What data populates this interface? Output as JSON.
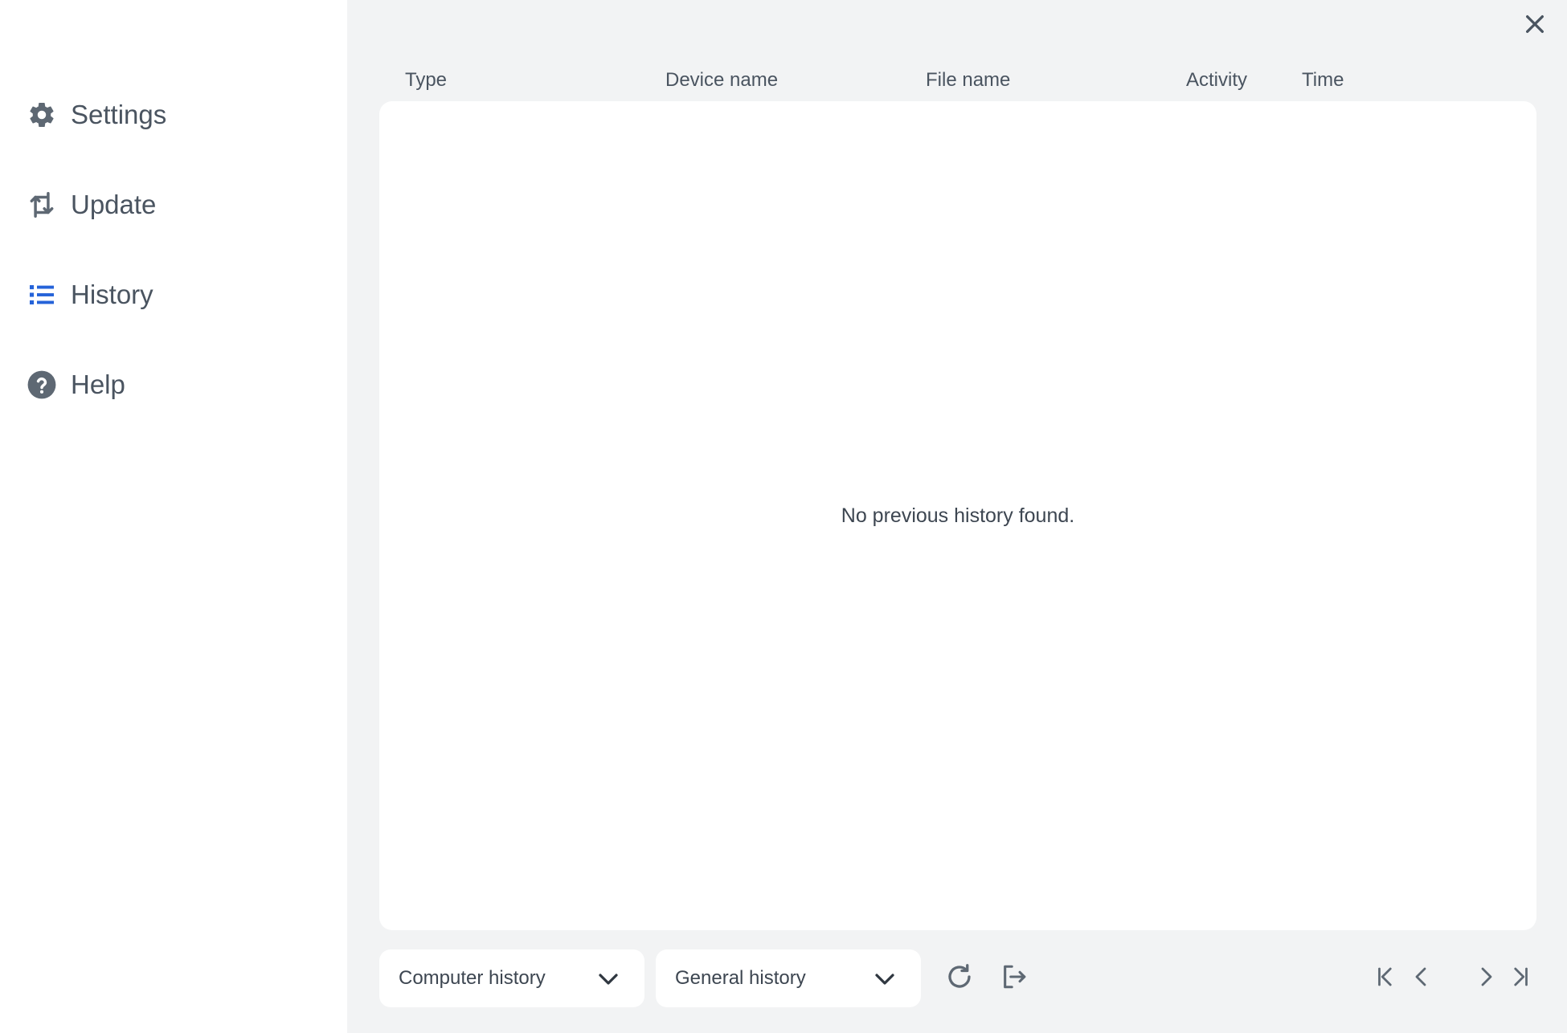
{
  "sidebar": {
    "items": [
      {
        "label": "Settings",
        "icon": "gear-icon"
      },
      {
        "label": "Update",
        "icon": "update-icon"
      },
      {
        "label": "History",
        "icon": "list-icon",
        "active": true
      },
      {
        "label": "Help",
        "icon": "help-icon"
      }
    ]
  },
  "table": {
    "columns": [
      "Type",
      "Device name",
      "File name",
      "Activity",
      "Time"
    ],
    "empty_message": "No previous history found."
  },
  "footer": {
    "scope_dropdown": {
      "value": "Computer history"
    },
    "kind_dropdown": {
      "value": "General history"
    }
  },
  "colors": {
    "accent": "#2563d9",
    "icon_gray": "#5e6873",
    "main_bg": "#f2f3f4",
    "panel_bg": "#ffffff"
  }
}
